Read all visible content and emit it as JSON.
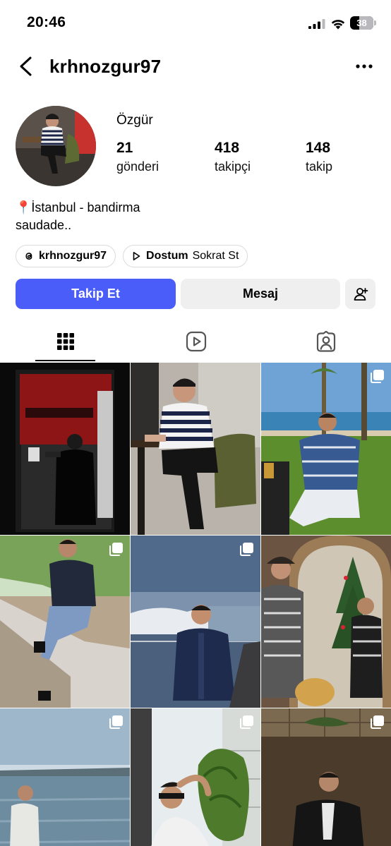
{
  "status_bar": {
    "time": "20:46",
    "battery": "38",
    "battery_level": 0.38
  },
  "header": {
    "username": "krhnozgur97",
    "back_icon": "chevron-left-icon",
    "more_icon": "ellipsis-icon"
  },
  "profile": {
    "display_name": "Özgür",
    "stats": [
      {
        "count": "21",
        "label": "gönderi"
      },
      {
        "count": "418",
        "label": "takipçi"
      },
      {
        "count": "148",
        "label": "takip"
      }
    ],
    "bio_line1": "📍İstanbul - bandirma",
    "bio_line2": "saudade..",
    "threads_handle": "krhnozgur97",
    "music_title": "Dostum",
    "music_artist": "Sokrat St"
  },
  "actions": {
    "follow": "Takip Et",
    "message": "Mesaj"
  },
  "tabs": [
    "grid-icon",
    "reels-icon",
    "tagged-icon"
  ],
  "colors": {
    "accent": "#4a5df9",
    "secondary_button": "#efefef"
  },
  "posts": [
    {
      "subject": "shooting range",
      "carousel": false
    },
    {
      "subject": "man in striped sweater seated",
      "carousel": false
    },
    {
      "subject": "man at seaside park",
      "carousel": true
    },
    {
      "subject": "man sitting on wall with trees",
      "carousel": true
    },
    {
      "subject": "man at bosphorus",
      "carousel": true
    },
    {
      "subject": "man with christmas tree",
      "carousel": false
    },
    {
      "subject": "man at lake shore",
      "carousel": true
    },
    {
      "subject": "man with sunglasses and plants",
      "carousel": true
    },
    {
      "subject": "man in dark interior",
      "carousel": true
    }
  ]
}
